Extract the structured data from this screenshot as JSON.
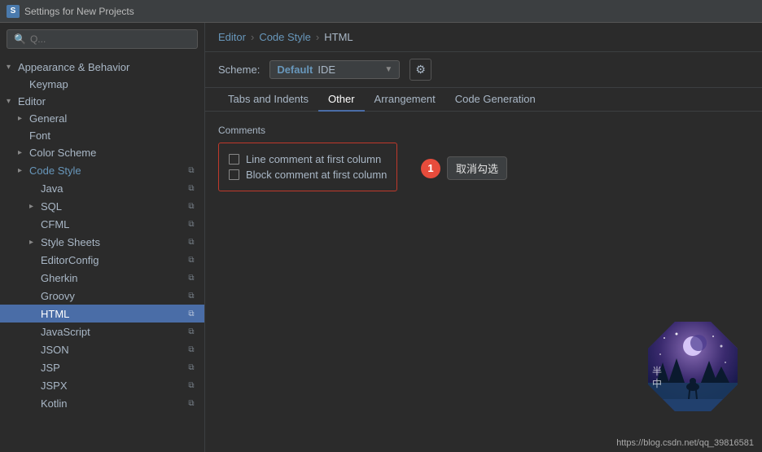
{
  "titleBar": {
    "icon": "S",
    "title": "Settings for New Projects"
  },
  "sidebar": {
    "searchPlaceholder": "Q...",
    "items": [
      {
        "id": "appearance-behavior",
        "label": "Appearance & Behavior",
        "indent": 0,
        "hasArrow": true,
        "arrowOpen": true,
        "isSection": true
      },
      {
        "id": "keymap",
        "label": "Keymap",
        "indent": 1,
        "hasArrow": false
      },
      {
        "id": "editor",
        "label": "Editor",
        "indent": 0,
        "hasArrow": true,
        "arrowOpen": true,
        "isSection": true
      },
      {
        "id": "general",
        "label": "General",
        "indent": 1,
        "hasArrow": true,
        "arrowOpen": false
      },
      {
        "id": "font",
        "label": "Font",
        "indent": 1,
        "hasArrow": false
      },
      {
        "id": "color-scheme",
        "label": "Color Scheme",
        "indent": 1,
        "hasArrow": true,
        "arrowOpen": false
      },
      {
        "id": "code-style",
        "label": "Code Style",
        "indent": 1,
        "hasArrow": true,
        "arrowOpen": false,
        "isHighlight": true,
        "hasCopyIcon": true
      },
      {
        "id": "java",
        "label": "Java",
        "indent": 2,
        "hasArrow": false,
        "hasCopyIcon": true
      },
      {
        "id": "sql",
        "label": "SQL",
        "indent": 2,
        "hasArrow": true,
        "arrowOpen": false,
        "hasCopyIcon": true
      },
      {
        "id": "cfml",
        "label": "CFML",
        "indent": 2,
        "hasArrow": false,
        "hasCopyIcon": true
      },
      {
        "id": "style-sheets",
        "label": "Style Sheets",
        "indent": 2,
        "hasArrow": true,
        "arrowOpen": false,
        "hasCopyIcon": true
      },
      {
        "id": "editor-config",
        "label": "EditorConfig",
        "indent": 2,
        "hasArrow": false,
        "hasCopyIcon": true
      },
      {
        "id": "gherkin",
        "label": "Gherkin",
        "indent": 2,
        "hasArrow": false,
        "hasCopyIcon": true
      },
      {
        "id": "groovy",
        "label": "Groovy",
        "indent": 2,
        "hasArrow": false,
        "hasCopyIcon": true
      },
      {
        "id": "html",
        "label": "HTML",
        "indent": 2,
        "hasArrow": false,
        "hasCopyIcon": true,
        "selected": true
      },
      {
        "id": "javascript",
        "label": "JavaScript",
        "indent": 2,
        "hasArrow": false,
        "hasCopyIcon": true
      },
      {
        "id": "json",
        "label": "JSON",
        "indent": 2,
        "hasArrow": false,
        "hasCopyIcon": true
      },
      {
        "id": "jsp",
        "label": "JSP",
        "indent": 2,
        "hasArrow": false,
        "hasCopyIcon": true
      },
      {
        "id": "jspx",
        "label": "JSPX",
        "indent": 2,
        "hasArrow": false,
        "hasCopyIcon": true
      },
      {
        "id": "kotlin",
        "label": "Kotlin",
        "indent": 2,
        "hasArrow": false,
        "hasCopyIcon": true
      }
    ]
  },
  "rightPanel": {
    "breadcrumb": [
      "Editor",
      "Code Style",
      "HTML"
    ],
    "scheme": {
      "label": "Scheme:",
      "defaultText": "Default",
      "ideText": "IDE"
    },
    "tabs": [
      {
        "id": "tabs-indents",
        "label": "Tabs and Indents"
      },
      {
        "id": "other",
        "label": "Other"
      },
      {
        "id": "arrangement",
        "label": "Arrangement"
      },
      {
        "id": "code-generation",
        "label": "Code Generation"
      }
    ],
    "activeTab": "other",
    "comments": {
      "sectionTitle": "Comments",
      "checkboxes": [
        {
          "id": "line-comment",
          "label": "Line comment at first column",
          "checked": false
        },
        {
          "id": "block-comment",
          "label": "Block comment at first column",
          "checked": false
        }
      ]
    },
    "tooltip": {
      "number": "1",
      "text": "取消勾选"
    },
    "urlText": "https://blog.csdn.net/qq_39816581"
  }
}
